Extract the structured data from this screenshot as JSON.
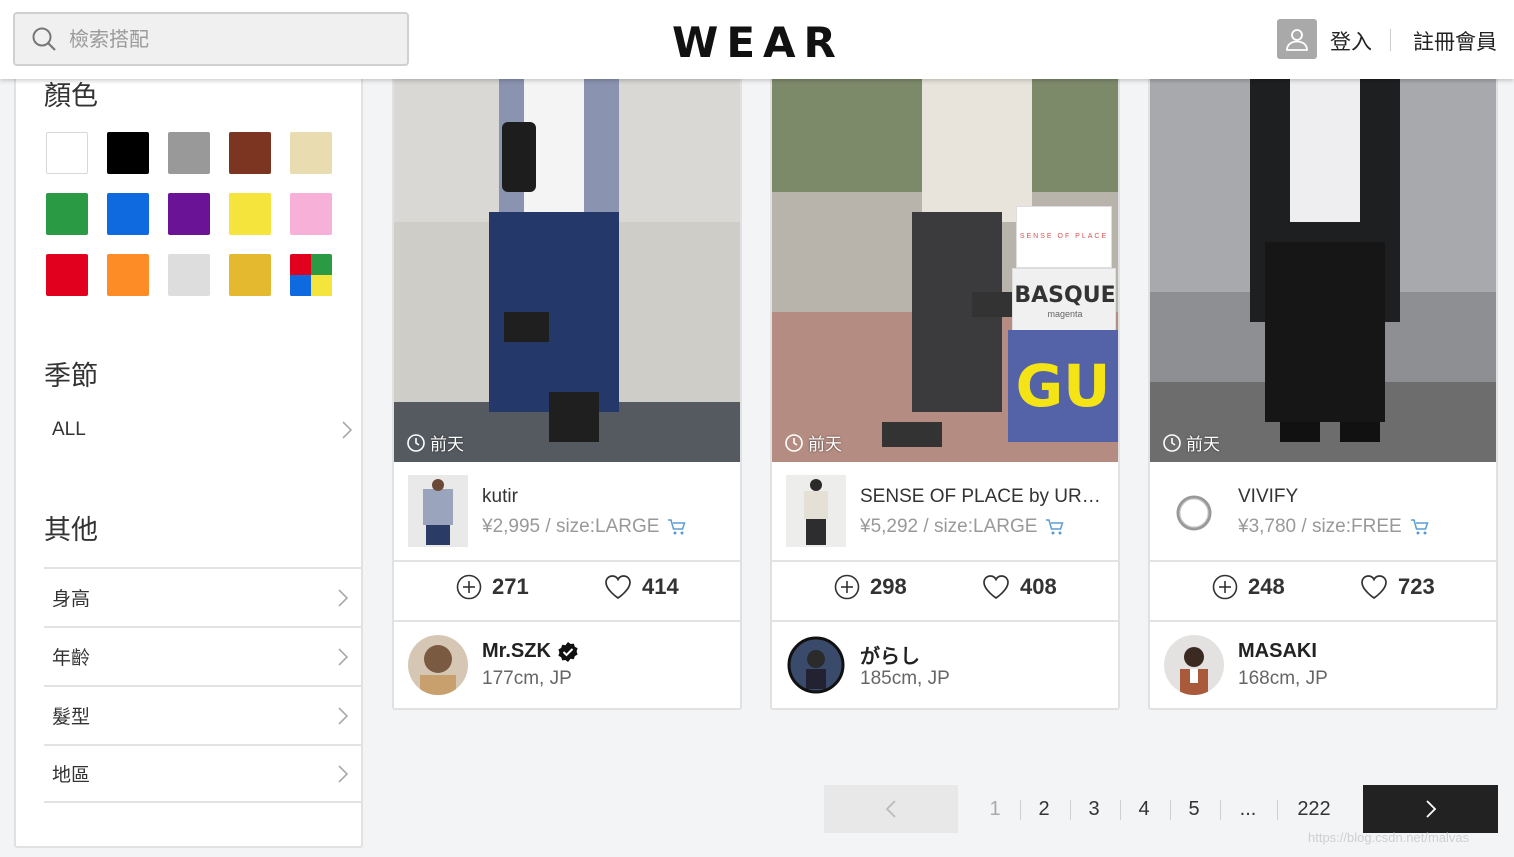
{
  "header": {
    "search_placeholder": "檢索搭配",
    "logo": "WEAR",
    "login": "登入",
    "register": "註冊會員"
  },
  "sidebar": {
    "color_title": "顏色",
    "colors": [
      "#ffffff",
      "#000000",
      "#999999",
      "#7b3520",
      "#e8dcb0",
      "#2a9a44",
      "#0f6ae0",
      "#6a1397",
      "#f5e43c",
      "#f7b0d8",
      "#e2001f",
      "#fd8c26",
      "#dddddd",
      "#e5b92f",
      "multi"
    ],
    "season_title": "季節",
    "season_value": "ALL",
    "other_title": "其他",
    "filters": [
      "身高",
      "年齡",
      "髮型",
      "地區"
    ]
  },
  "cards": [
    {
      "time": "前天",
      "item_brand": "kutir",
      "item_price": "¥2,995 / size:LARGE",
      "saves": "271",
      "likes": "414",
      "user_name": "Mr.SZK",
      "user_info": "177cm, JP",
      "verified": true
    },
    {
      "time": "前天",
      "item_brand": "SENSE OF PLACE by URBAN RESEARCH",
      "item_price": "¥5,292 / size:LARGE",
      "saves": "298",
      "likes": "408",
      "user_name": "がらし",
      "user_info": "185cm, JP",
      "verified": false,
      "brand_tags": [
        "SENSE OF PLACE",
        "BASQUE",
        "magenta",
        "GU"
      ]
    },
    {
      "time": "前天",
      "item_brand": "VIVIFY",
      "item_price": "¥3,780 / size:FREE",
      "saves": "248",
      "likes": "723",
      "user_name": "MASAKI",
      "user_info": "168cm, JP",
      "verified": false
    }
  ],
  "pagination": {
    "pages": [
      "1",
      "2",
      "3",
      "4",
      "5",
      "...",
      "222"
    ],
    "current": "1"
  },
  "watermark": "https://blog.csdn.net/malvas",
  "colors": {
    "accent": "#222222",
    "cart": "#5b9bd5"
  }
}
